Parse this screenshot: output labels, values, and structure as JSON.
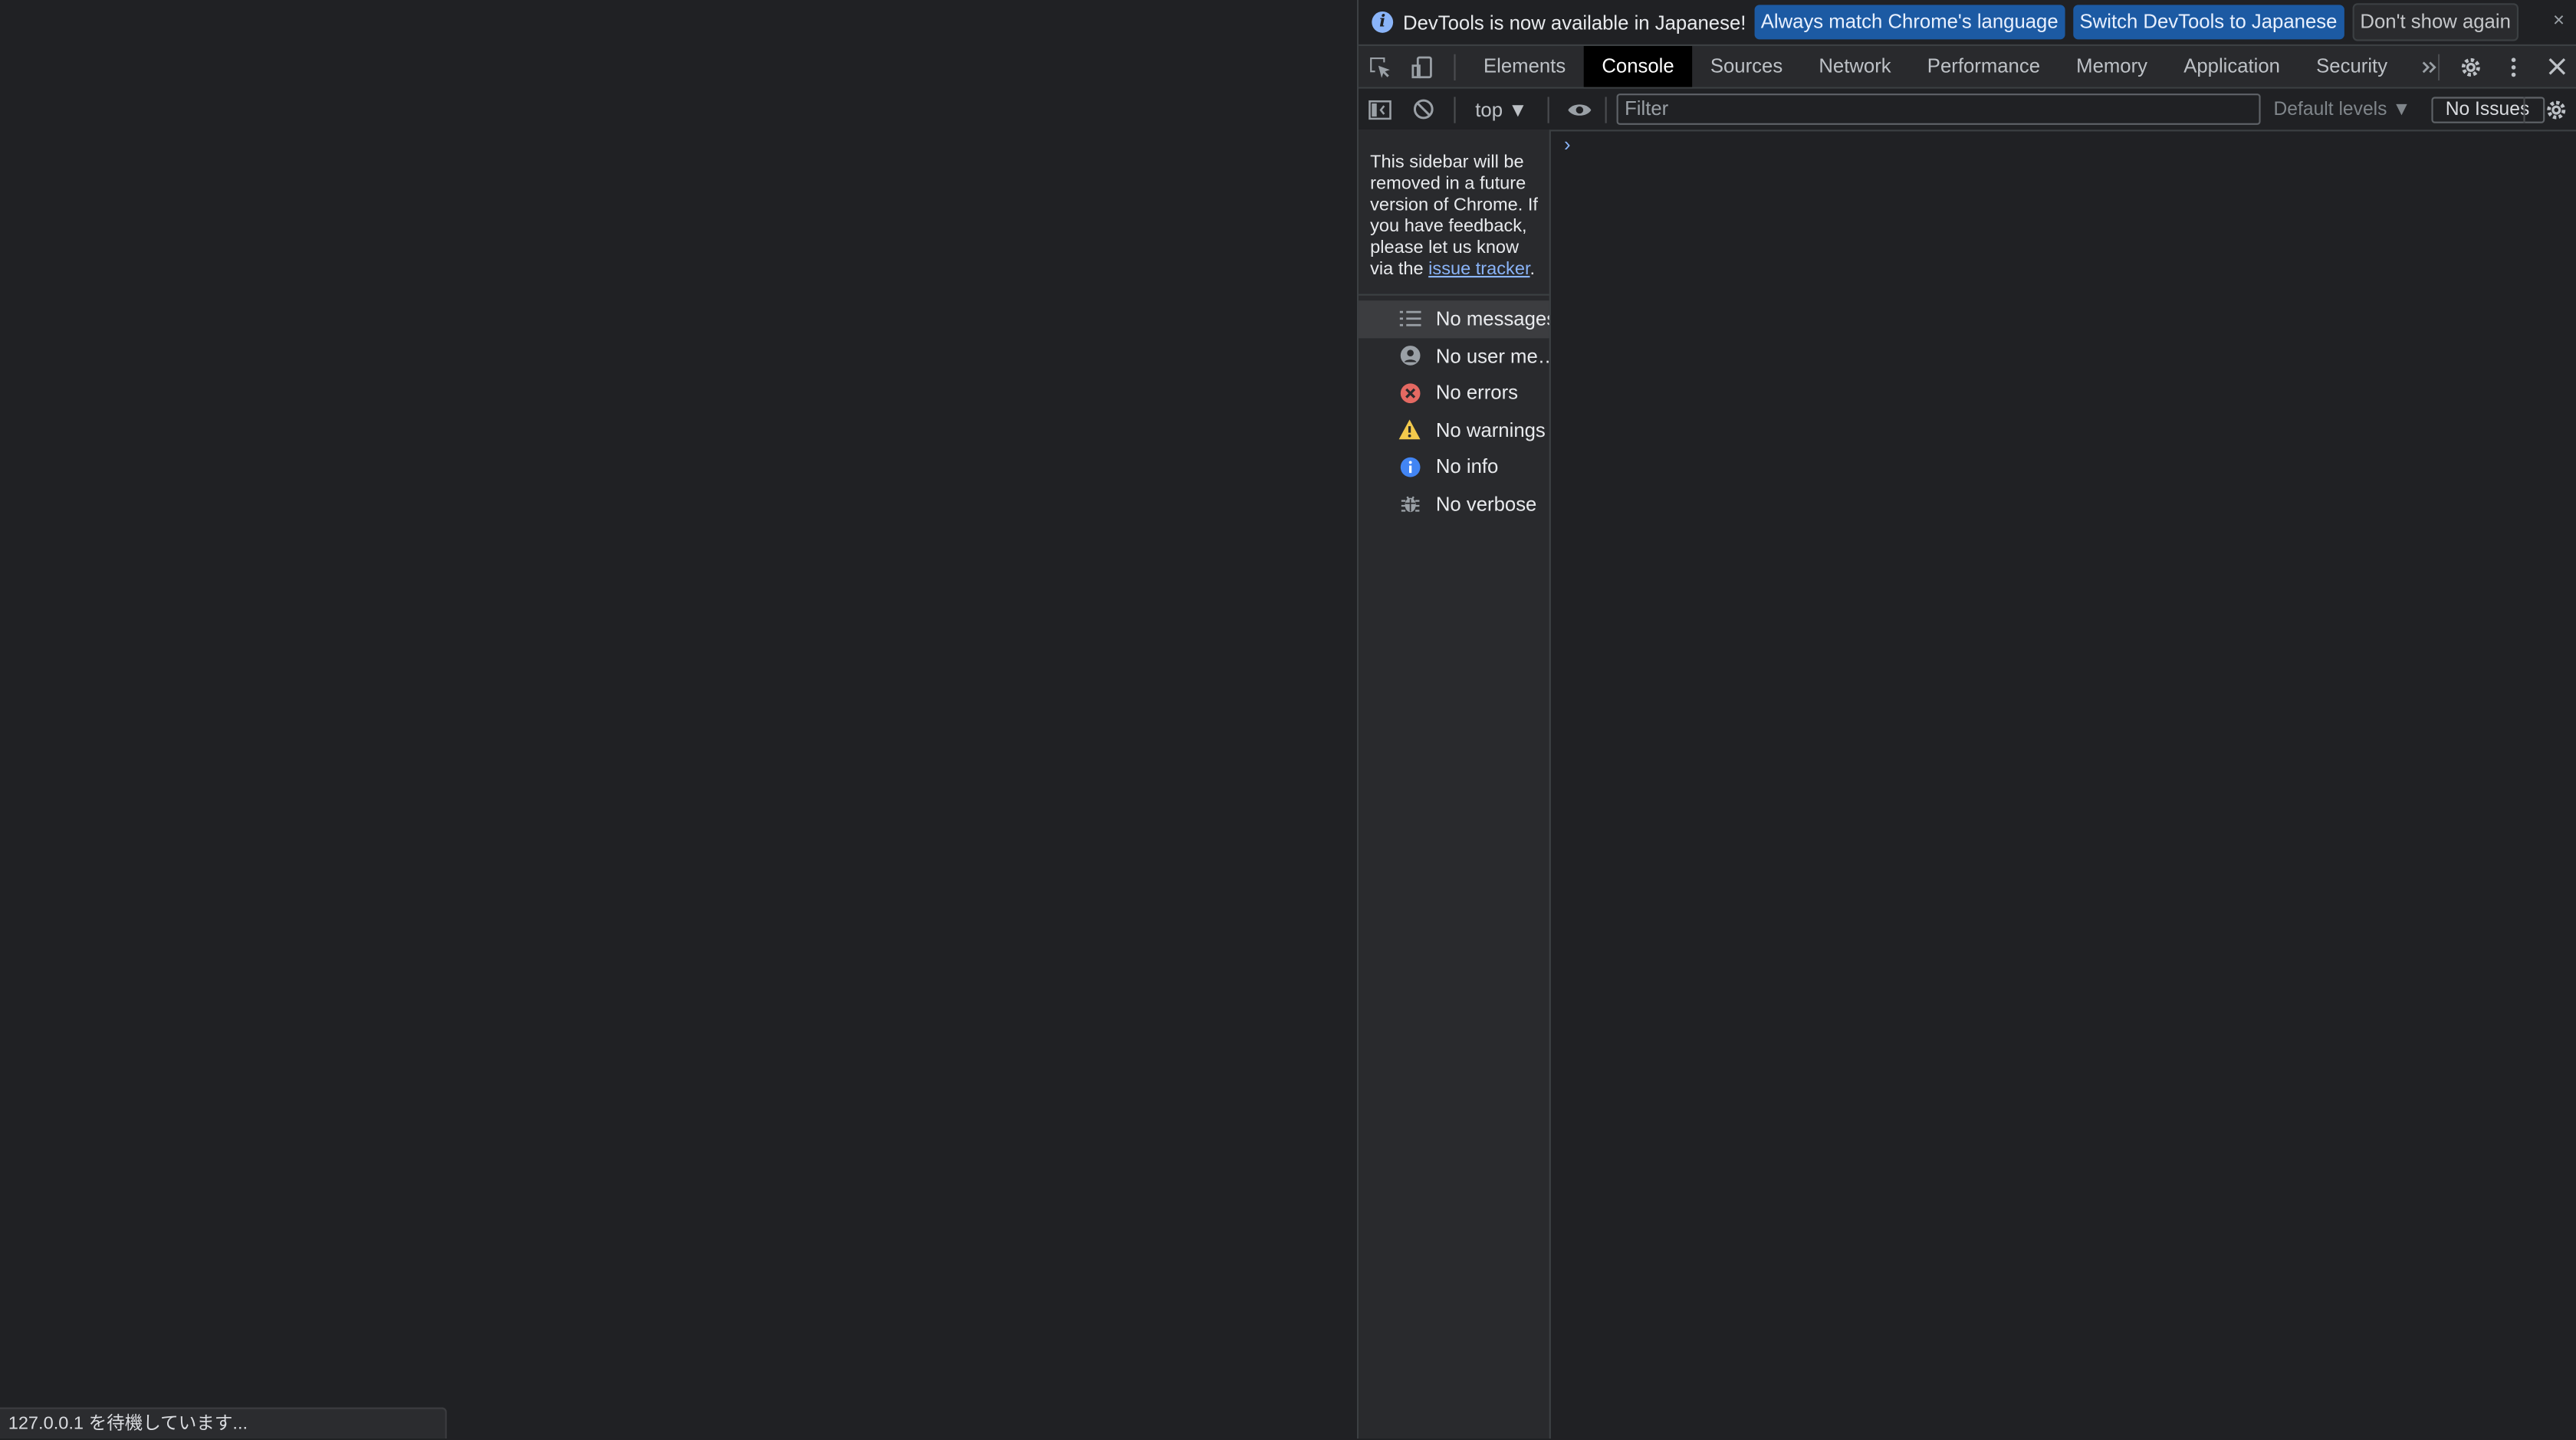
{
  "status_bar": {
    "text": "127.0.0.1 を待機しています..."
  },
  "infobar": {
    "message": "DevTools is now available in Japanese!",
    "btn_always": "Always match Chrome's language",
    "btn_switch": "Switch DevTools to Japanese",
    "btn_dont_show": "Don't show again",
    "close": "×"
  },
  "tabs": [
    "Elements",
    "Console",
    "Sources",
    "Network",
    "Performance",
    "Memory",
    "Application",
    "Security"
  ],
  "tab_labels": {
    "elements": "Elements",
    "console": "Console",
    "sources": "Sources",
    "network": "Network",
    "performance": "Performance",
    "memory": "Memory",
    "application": "Application",
    "security": "Security"
  },
  "toolbar": {
    "context": "top ▼",
    "filter_placeholder": "Filter",
    "levels": "Default levels ▼",
    "issues": "No Issues"
  },
  "sidebar": {
    "note_pre": "This sidebar will be removed in a future version of Chrome. If you have feedback, please let us know via the",
    "note_link": "issue tracker",
    "note_post": ".",
    "items": [
      {
        "label": "No messages",
        "icon": "list-icon"
      },
      {
        "label": "No user me…",
        "icon": "user-icon"
      },
      {
        "label": "No errors",
        "icon": "error-icon"
      },
      {
        "label": "No warnings",
        "icon": "warning-icon"
      },
      {
        "label": "No info",
        "icon": "info-icon"
      },
      {
        "label": "No verbose",
        "icon": "bug-icon"
      }
    ]
  },
  "colors": {
    "accent": "#8ab4f8",
    "error": "#e46962",
    "warning": "#f2c94c",
    "info": "#4285f4",
    "bg": "#202124"
  },
  "console_prompt": "›"
}
